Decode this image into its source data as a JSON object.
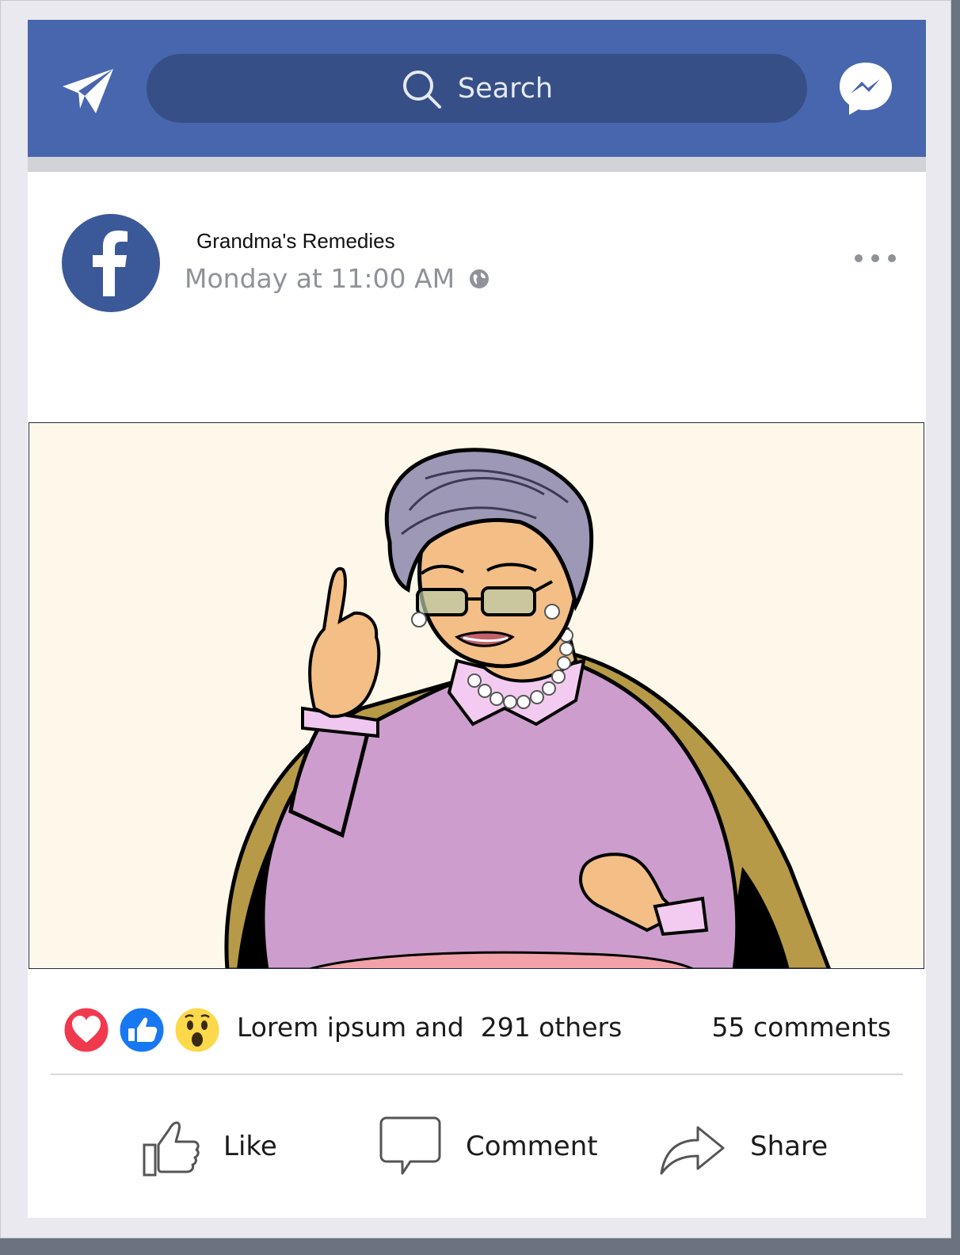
{
  "header": {
    "search_placeholder": "Search",
    "brand_color": "#4866ad",
    "search_bg_color": "#364f86"
  },
  "post": {
    "page_name": "Grandma's Remedies",
    "timestamp": "Monday at 11:00 AM",
    "image_alt": "Illustration of a grandmother in a lilac sweater and pearl necklace raising her index finger"
  },
  "stats": {
    "reactions_text": "Lorem ipsum and  291 others",
    "comments_text": "55 comments",
    "reaction_icons": [
      "heart-icon",
      "thumbs-up-icon",
      "wow-face-icon"
    ]
  },
  "actions": {
    "like_label": "Like",
    "comment_label": "Comment",
    "share_label": "Share"
  }
}
